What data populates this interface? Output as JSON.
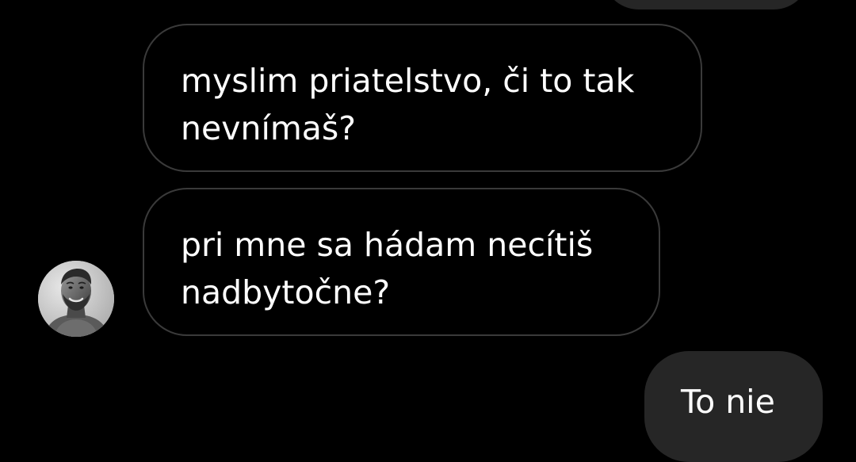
{
  "conversation": {
    "messages": [
      {
        "id": "msg-prev",
        "direction": "outgoing",
        "lines": []
      },
      {
        "id": "msg-1",
        "direction": "incoming",
        "lines": [
          "myslim priatelstvo, či to tak",
          "nevnímaš?"
        ]
      },
      {
        "id": "msg-2",
        "direction": "incoming",
        "lines": [
          "pri mne sa hádam necítiš",
          "nadbytočne?"
        ]
      },
      {
        "id": "msg-3",
        "direction": "outgoing",
        "lines": [
          "To nie"
        ]
      }
    ],
    "avatar": {
      "icon": "person-avatar-icon",
      "tone": "grayscale"
    }
  },
  "colors": {
    "background": "#000000",
    "incoming_bubble_border": "#3a3a3a",
    "outgoing_bubble_fill": "#262626",
    "text": "#ffffff"
  }
}
